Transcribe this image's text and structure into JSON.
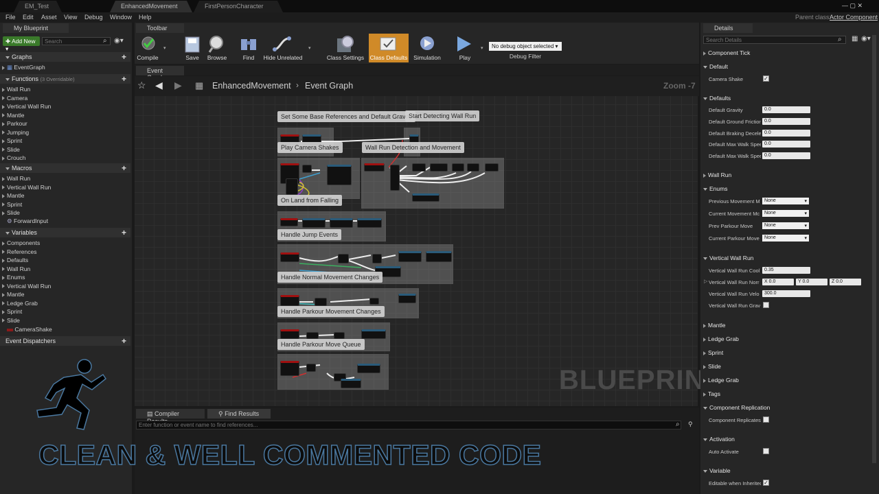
{
  "tabs": [
    "EM_Test",
    "EnhancedMovement",
    "FirstPersonCharacter"
  ],
  "menu": [
    "File",
    "Edit",
    "Asset",
    "View",
    "Debug",
    "Window",
    "Help"
  ],
  "parent_class_label": "Parent class:",
  "parent_class_value": "Actor Component",
  "my_blueprint": {
    "tab": "My Blueprint",
    "add_new": "Add New",
    "search_placeholder": "Search",
    "graphs_header": "Graphs",
    "graphs_item": "EventGraph",
    "functions_header": "Functions",
    "functions_note": "(3 Overridable)",
    "functions": [
      "Wall Run",
      "Camera",
      "Vertical Wall Run",
      "Mantle",
      "Parkour",
      "Jumping",
      "Sprint",
      "Slide",
      "Crouch"
    ],
    "macros_header": "Macros",
    "macros": [
      "Wall Run",
      "Vertical Wall Run",
      "Mantle",
      "Sprint",
      "Slide"
    ],
    "macro_extra": "ForwardInput",
    "variables_header": "Variables",
    "variables": [
      "Components",
      "References",
      "Defaults",
      "Wall Run",
      "Enums",
      "Vertical Wall Run",
      "Mantle",
      "Ledge Grab",
      "Sprint",
      "Slide"
    ],
    "variable_extra": "CameraShake",
    "dispatchers_header": "Event Dispatchers"
  },
  "toolbar": {
    "tab": "Toolbar",
    "compile": "Compile",
    "save": "Save",
    "browse": "Browse",
    "find": "Find",
    "hide_unrelated": "Hide Unrelated",
    "class_settings": "Class Settings",
    "class_defaults": "Class Defaults",
    "simulation": "Simulation",
    "play": "Play",
    "debug_select": "No debug object selected",
    "debug_filter": "Debug Filter"
  },
  "graph": {
    "tab": "Event Graph",
    "breadcrumb_bp": "EnhancedMovement",
    "breadcrumb_graph": "Event Graph",
    "zoom": "Zoom -7",
    "watermark": "BLUEPRINT",
    "comments": [
      "Set Some Base References and Default Gravity",
      "Start Detecting Wall Run",
      "Play Camera Shakes",
      "Wall Run Detection and Movement",
      "On Land from Falling",
      "Handle Jump Events",
      "Handle Normal Movement Changes",
      "Handle Parkour Movement Changes",
      "Handle Parkour Move Queue"
    ]
  },
  "bottom": {
    "compiler_tab": "Compiler Results",
    "find_tab": "Find Results",
    "find_placeholder": "Enter function or event name to find references..."
  },
  "overlay_text": "CLEAN & WELL COMMENTED CODE",
  "details": {
    "tab": "Details",
    "search_placeholder": "Search Details",
    "component_tick": "Component Tick",
    "default_header": "Default",
    "camera_shake": "Camera Shake",
    "defaults_header": "Defaults",
    "defaults_rows": [
      {
        "label": "Default Gravity",
        "value": "0.0"
      },
      {
        "label": "Default Ground Friction",
        "value": "0.0"
      },
      {
        "label": "Default Braking Decele",
        "value": "0.0"
      },
      {
        "label": "Default Max Walk Spee",
        "value": "0.0"
      },
      {
        "label": "Default Max Walk Spee",
        "value": "0.0"
      }
    ],
    "wall_run_header": "Wall Run",
    "enums_header": "Enums",
    "enum_rows": [
      {
        "label": "Previous Movement M",
        "value": "None"
      },
      {
        "label": "Current Movement Mc",
        "value": "None"
      },
      {
        "label": "Prev Parkour Move",
        "value": "None"
      },
      {
        "label": "Current Parkour Move",
        "value": "None"
      }
    ],
    "vwr_header": "Vertical Wall Run",
    "vwr_cool": {
      "label": "Vertical Wall Run Cool",
      "value": "0.35"
    },
    "vwr_norm": {
      "label": "Vertical Wall Run Norr",
      "x": "X 0.0",
      "y": "Y 0.0",
      "z": "Z 0.0"
    },
    "vwr_velo": {
      "label": "Vertical Wall Run Velo",
      "value": "300.0"
    },
    "vwr_grav": {
      "label": "Vertical Wall Run Grav"
    },
    "collapsed_sections": [
      "Mantle",
      "Ledge Grab",
      "Sprint",
      "Slide",
      "Ledge Grab",
      "Tags"
    ],
    "component_replication_header": "Component Replication",
    "component_replicates": "Component Replicates",
    "activation_header": "Activation",
    "auto_activate": "Auto Activate",
    "variable_header": "Variable",
    "editable": "Editable when Inherited"
  }
}
